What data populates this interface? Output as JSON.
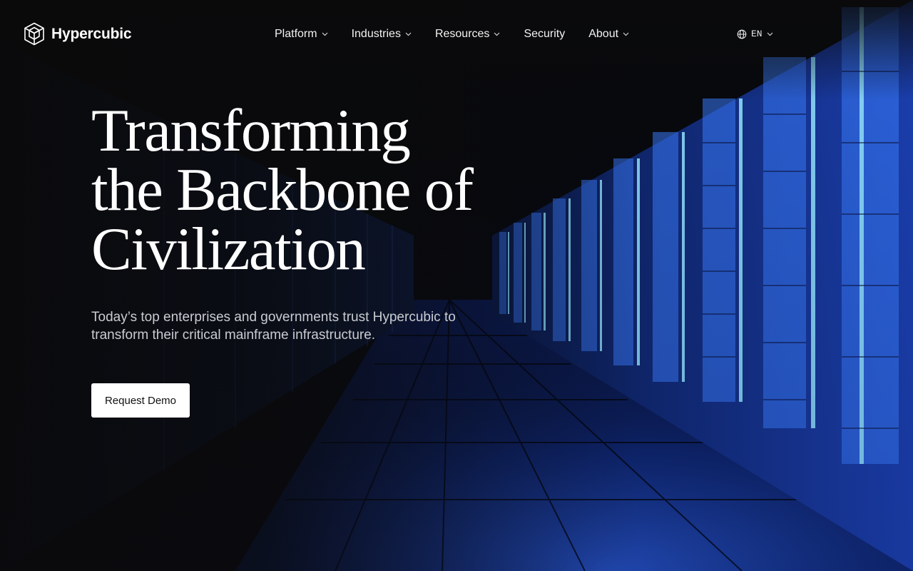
{
  "brand": {
    "name": "Hypercubic",
    "logo_icon": "cube-icon"
  },
  "nav": {
    "items": [
      {
        "label": "Platform",
        "has_dropdown": true
      },
      {
        "label": "Industries",
        "has_dropdown": true
      },
      {
        "label": "Resources",
        "has_dropdown": true
      },
      {
        "label": "Security",
        "has_dropdown": false
      },
      {
        "label": "About",
        "has_dropdown": true
      }
    ]
  },
  "language": {
    "label": "EN",
    "icon": "globe-icon"
  },
  "hero": {
    "headline_lines": [
      "Transforming",
      "the Backbone of",
      "Civilization"
    ],
    "subtext_lines": [
      "Today’s top enterprises and governments trust Hypercubic to",
      "transform their critical mainframe infrastructure."
    ],
    "cta_label": "Request Demo",
    "background": "server-room-corridor-image"
  },
  "colors": {
    "background": "#0a0a0b",
    "accent_blue": "#2f6bff",
    "glow_cyan": "#7fd8ff",
    "cta_bg": "#ffffff"
  }
}
